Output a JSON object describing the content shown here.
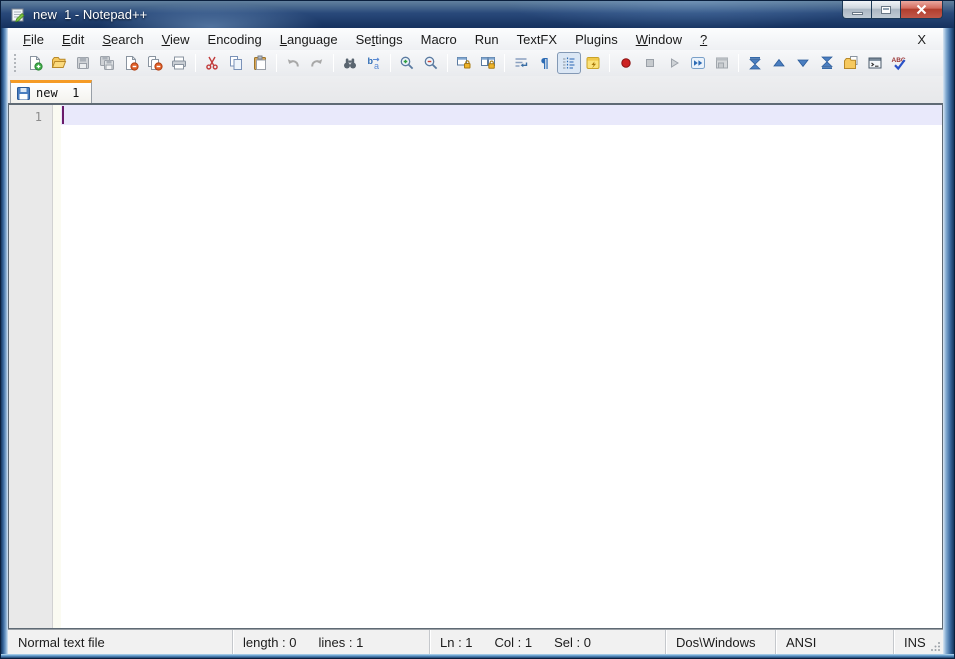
{
  "window": {
    "title": "new  1 - Notepad++",
    "app_icon": "notepad-plus-plus-icon",
    "controls": [
      {
        "name": "minimize"
      },
      {
        "name": "maximize"
      },
      {
        "name": "close"
      }
    ]
  },
  "menu_bar": {
    "items": [
      {
        "label": "File",
        "pre": "",
        "key": "F",
        "post": "ile"
      },
      {
        "label": "Edit",
        "pre": "",
        "key": "E",
        "post": "dit"
      },
      {
        "label": "Search",
        "pre": "",
        "key": "S",
        "post": "earch"
      },
      {
        "label": "View",
        "pre": "",
        "key": "V",
        "post": "iew"
      },
      {
        "label": "Encoding",
        "pre": "Encoding",
        "key": "",
        "post": ""
      },
      {
        "label": "Language",
        "pre": "",
        "key": "L",
        "post": "anguage"
      },
      {
        "label": "Settings",
        "pre": "Se",
        "key": "t",
        "post": "tings"
      },
      {
        "label": "Macro",
        "pre": "Macro",
        "key": "",
        "post": ""
      },
      {
        "label": "Run",
        "pre": "Run",
        "key": "",
        "post": ""
      },
      {
        "label": "TextFX",
        "pre": "TextFX",
        "key": "",
        "post": ""
      },
      {
        "label": "Plugins",
        "pre": "Plugins",
        "key": "",
        "post": ""
      },
      {
        "label": "Window",
        "pre": "",
        "key": "W",
        "post": "indow"
      },
      {
        "label": "?",
        "pre": "",
        "key": "?",
        "post": ""
      }
    ],
    "close_glyph": "X"
  },
  "toolbar": {
    "buttons": [
      {
        "name": "new-file",
        "state": "enabled"
      },
      {
        "name": "open-file",
        "state": "enabled"
      },
      {
        "name": "save-file",
        "state": "disabled"
      },
      {
        "name": "save-all",
        "state": "disabled"
      },
      {
        "name": "close-file",
        "state": "enabled"
      },
      {
        "name": "close-all",
        "state": "enabled"
      },
      {
        "name": "print",
        "state": "enabled"
      },
      {
        "name": "cut",
        "state": "enabled"
      },
      {
        "name": "copy",
        "state": "enabled"
      },
      {
        "name": "paste",
        "state": "enabled"
      },
      {
        "name": "undo",
        "state": "disabled"
      },
      {
        "name": "redo",
        "state": "disabled"
      },
      {
        "name": "find",
        "state": "enabled"
      },
      {
        "name": "replace",
        "state": "enabled"
      },
      {
        "name": "zoom-in",
        "state": "enabled"
      },
      {
        "name": "zoom-out",
        "state": "enabled"
      },
      {
        "name": "sync-scroll-vertical",
        "state": "enabled"
      },
      {
        "name": "sync-scroll-horizontal",
        "state": "enabled"
      },
      {
        "name": "word-wrap",
        "state": "enabled"
      },
      {
        "name": "show-all-characters",
        "state": "enabled"
      },
      {
        "name": "show-indent-guide",
        "state": "pressed"
      },
      {
        "name": "user-defined-dialog",
        "state": "enabled"
      },
      {
        "name": "macro-record",
        "state": "enabled"
      },
      {
        "name": "macro-stop",
        "state": "disabled"
      },
      {
        "name": "macro-playback",
        "state": "disabled"
      },
      {
        "name": "macro-run-multiple",
        "state": "enabled"
      },
      {
        "name": "macro-save",
        "state": "disabled"
      },
      {
        "name": "nav-first",
        "state": "enabled"
      },
      {
        "name": "nav-previous",
        "state": "enabled"
      },
      {
        "name": "nav-next",
        "state": "enabled"
      },
      {
        "name": "nav-last",
        "state": "enabled"
      },
      {
        "name": "explorer",
        "state": "enabled"
      },
      {
        "name": "console",
        "state": "enabled"
      },
      {
        "name": "spell-check",
        "state": "enabled"
      }
    ]
  },
  "tab_bar": {
    "tabs": [
      {
        "label": "new  1",
        "icon": "saved-floppy-icon",
        "active": true
      }
    ]
  },
  "editor": {
    "line_numbers": [
      "1"
    ],
    "content": ""
  },
  "status_bar": {
    "doc_type": "Normal text file",
    "length": "length : 0",
    "lines": "lines : 1",
    "line": "Ln : 1",
    "column": "Col : 1",
    "selection": "Sel : 0",
    "eol_format": "Dos\\Windows",
    "encoding": "ANSI",
    "insert_mode": "INS"
  },
  "colors": {
    "titlebar": "#29497a",
    "tab_accent": "#f59b26",
    "current_line": "#e9e9fb",
    "caret": "#6a1b6a",
    "close_button": "#b13d2d"
  }
}
